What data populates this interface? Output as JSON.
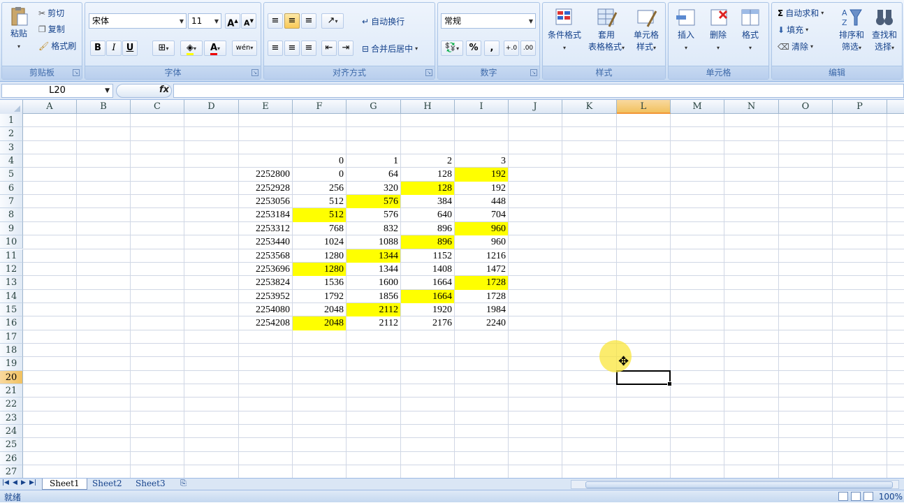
{
  "ribbon": {
    "clipboard": {
      "paste": "粘贴",
      "cut": "剪切",
      "copy": "复制",
      "format_painter": "格式刷",
      "label": "剪贴板"
    },
    "font": {
      "name": "宋体",
      "size": "11",
      "bold": "B",
      "italic": "I",
      "underline": "U",
      "color_letter": "A",
      "phonetic": "wén",
      "label": "字体"
    },
    "alignment": {
      "wrap": "自动换行",
      "merge": "合并后居中",
      "label": "对齐方式"
    },
    "number": {
      "format": "常规",
      "percent": "%",
      "comma": ",",
      "inc_decimal": "+.0",
      "dec_decimal": ".00",
      "label": "数字"
    },
    "styles": {
      "conditional_line1": "条件格式",
      "table_line1": "套用",
      "table_line2": "表格格式",
      "cell_line1": "单元格",
      "cell_line2": "样式",
      "label": "样式"
    },
    "cells": {
      "insert": "插入",
      "delete": "删除",
      "format": "格式",
      "label": "单元格"
    },
    "editing": {
      "autosum": "自动求和",
      "fill": "填充",
      "clear": "清除",
      "sort_line1": "排序和",
      "sort_line2": "筛选",
      "find_line1": "查找和",
      "find_line2": "选择",
      "label": "编辑"
    }
  },
  "formula_bar": {
    "name_box": "L20",
    "fx": "fx",
    "value": ""
  },
  "columns": [
    "A",
    "B",
    "C",
    "D",
    "E",
    "F",
    "G",
    "H",
    "I",
    "J",
    "K",
    "L",
    "M",
    "N",
    "O",
    "P"
  ],
  "selected_column": "L",
  "rows": [
    "1",
    "2",
    "3",
    "4",
    "5",
    "6",
    "7",
    "8",
    "9",
    "10",
    "11",
    "12",
    "13",
    "14",
    "15",
    "16",
    "17",
    "18",
    "19",
    "20",
    "21",
    "22",
    "23",
    "24",
    "25",
    "26",
    "27"
  ],
  "selected_row": "20",
  "highlight_color": "#ffff00",
  "table": {
    "header_row": [
      "",
      "0",
      "1",
      "2",
      "3"
    ],
    "data": [
      {
        "E": "2252800",
        "F": "0",
        "G": "64",
        "H": "128",
        "I": "192",
        "hl": "I"
      },
      {
        "E": "2252928",
        "F": "256",
        "G": "320",
        "H": "128",
        "I": "192",
        "hl": "H"
      },
      {
        "E": "2253056",
        "F": "512",
        "G": "576",
        "H": "384",
        "I": "448",
        "hl": "G"
      },
      {
        "E": "2253184",
        "F": "512",
        "G": "576",
        "H": "640",
        "I": "704",
        "hl": "F"
      },
      {
        "E": "2253312",
        "F": "768",
        "G": "832",
        "H": "896",
        "I": "960",
        "hl": "I"
      },
      {
        "E": "2253440",
        "F": "1024",
        "G": "1088",
        "H": "896",
        "I": "960",
        "hl": "H"
      },
      {
        "E": "2253568",
        "F": "1280",
        "G": "1344",
        "H": "1152",
        "I": "1216",
        "hl": "G"
      },
      {
        "E": "2253696",
        "F": "1280",
        "G": "1344",
        "H": "1408",
        "I": "1472",
        "hl": "F"
      },
      {
        "E": "2253824",
        "F": "1536",
        "G": "1600",
        "H": "1664",
        "I": "1728",
        "hl": "I"
      },
      {
        "E": "2253952",
        "F": "1792",
        "G": "1856",
        "H": "1664",
        "I": "1728",
        "hl": "H"
      },
      {
        "E": "2254080",
        "F": "2048",
        "G": "2112",
        "H": "1920",
        "I": "1984",
        "hl": "G"
      },
      {
        "E": "2254208",
        "F": "2048",
        "G": "2112",
        "H": "2176",
        "I": "2240",
        "hl": "F"
      }
    ]
  },
  "sheets": [
    {
      "name": "Sheet1",
      "active": true
    },
    {
      "name": "Sheet2",
      "active": false
    },
    {
      "name": "Sheet3",
      "active": false
    }
  ],
  "status": {
    "text": "就绪",
    "zoom": "100%"
  }
}
